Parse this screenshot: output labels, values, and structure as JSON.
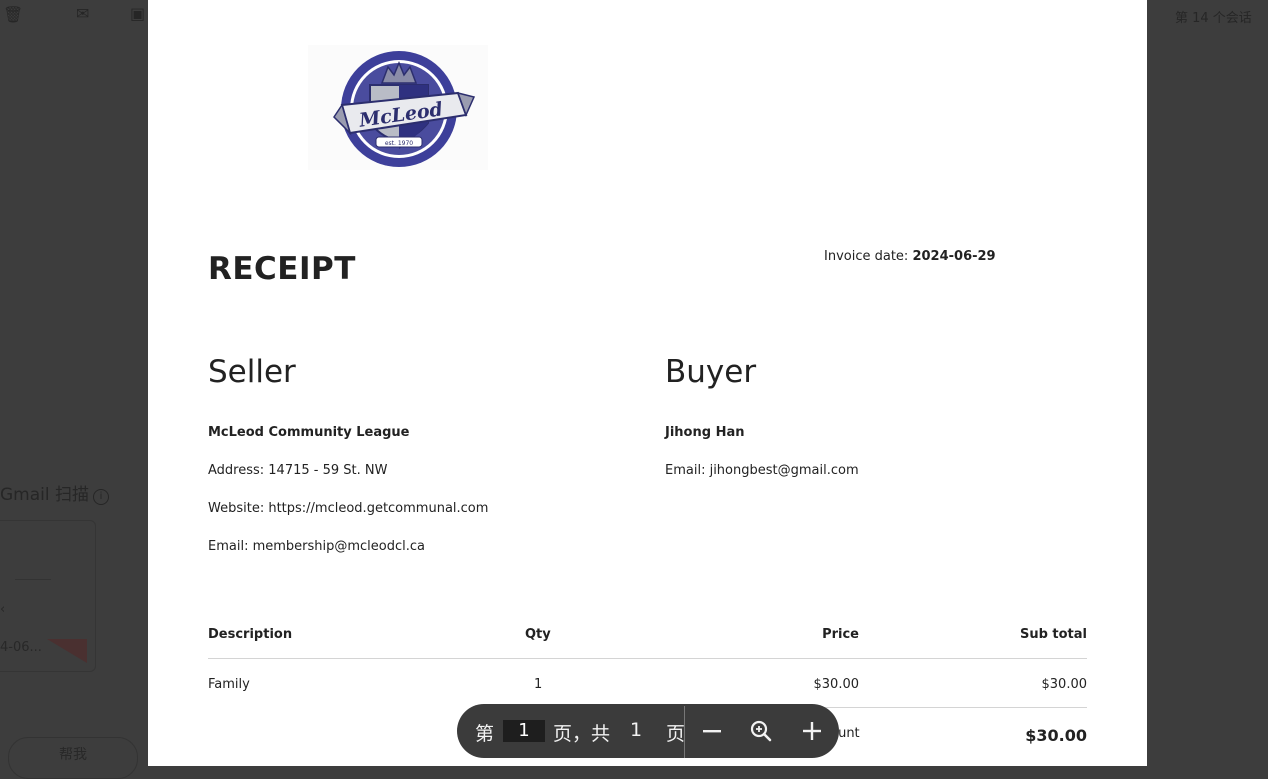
{
  "background": {
    "conversation_counter": "第 14 个会话",
    "gmail_scan_label": "Gmail 扫描",
    "truncated_date": "4-06...",
    "truncated_button": "帮我"
  },
  "receipt": {
    "logo": {
      "crest_text": "McLeod",
      "est": "est. 1970"
    },
    "title": "RECEIPT",
    "invoice_date_label": "Invoice date:",
    "invoice_date_value": "2024-06-29",
    "seller": {
      "heading": "Seller",
      "name": "McLeod Community League",
      "address": "Address: 14715 - 59 St. NW",
      "website": "Website: https://mcleod.getcommunal.com",
      "email": "Email: membership@mcleodcl.ca"
    },
    "buyer": {
      "heading": "Buyer",
      "name": "Jihong Han",
      "email": "Email: jihongbest@gmail.com"
    },
    "table": {
      "headers": {
        "description": "Description",
        "qty": "Qty",
        "price": "Price",
        "subtotal": "Sub total"
      },
      "rows": [
        {
          "description": "Family",
          "qty": "1",
          "price": "$30.00",
          "subtotal": "$30.00"
        }
      ],
      "total_label": "Total amount",
      "total_value": "$30.00"
    }
  },
  "pager": {
    "prefix": "第",
    "current_page": "1",
    "middle": "页，共",
    "total_pages": "1",
    "suffix": "页"
  },
  "icons": {
    "zoom_out": "minus-icon",
    "zoom_fit": "zoom-magnifier-icon",
    "zoom_in": "plus-icon"
  }
}
